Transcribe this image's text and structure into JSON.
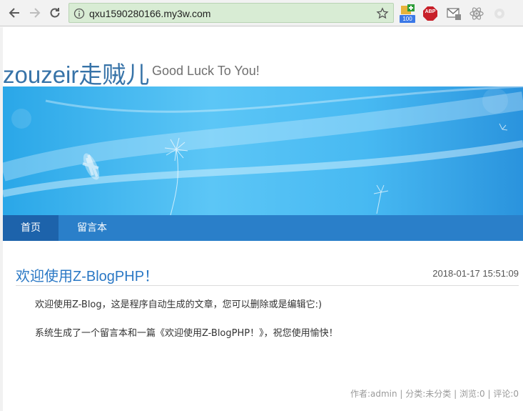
{
  "browser": {
    "url": "qxu1590280166.my3w.com",
    "extension_badge": "100",
    "abp_label": "ABP"
  },
  "site": {
    "title": "zouzeir走贼儿",
    "subtitle": "Good Luck To You!"
  },
  "nav": {
    "items": [
      {
        "label": "首页"
      },
      {
        "label": "留言本"
      }
    ]
  },
  "post": {
    "title": "欢迎使用Z-BlogPHP！",
    "date": "2018-01-17 15:51:09",
    "paragraphs": [
      "欢迎使用Z-Blog，这是程序自动生成的文章，您可以删除或是编辑它:)",
      "系统生成了一个留言本和一篇《欢迎使用Z-BlogPHP！》，祝您使用愉快！"
    ],
    "meta": "作者:admin | 分类:未分类 | 浏览:0 | 评论:0"
  },
  "colors": {
    "title": "#3773a8",
    "nav_bar": "#2a7fc9",
    "nav_active": "#1d63ab",
    "post_title": "#2a78c5"
  }
}
